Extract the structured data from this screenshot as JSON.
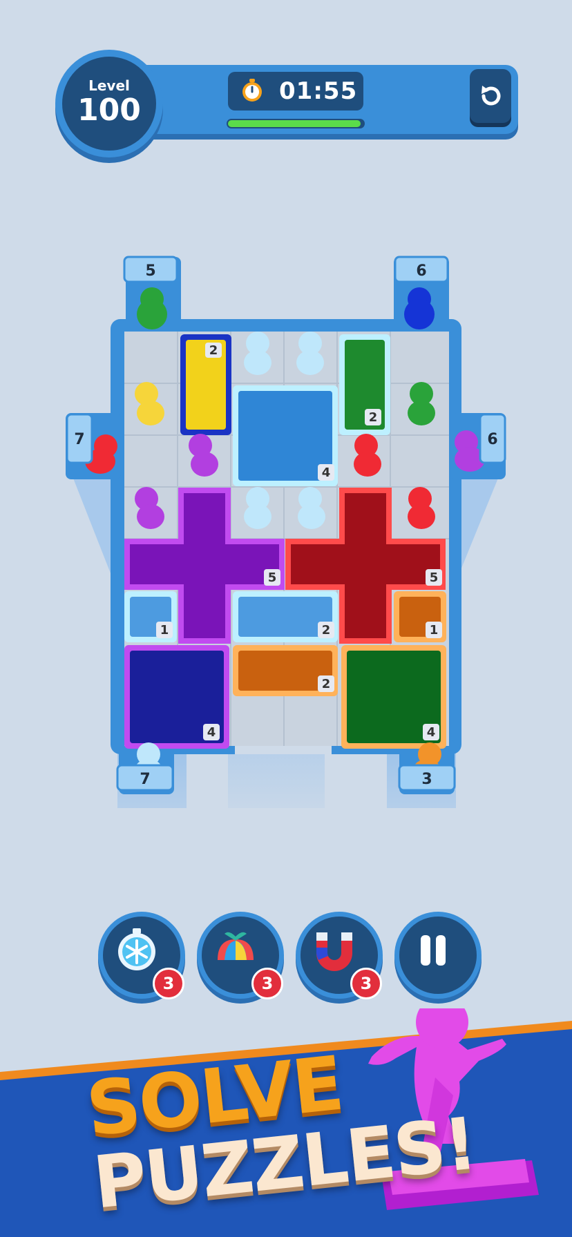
{
  "header": {
    "level_label": "Level",
    "level_number": "100",
    "timer": "01:55",
    "timer_progress": 0.98,
    "restart_icon": "restart-icon",
    "timer_icon": "stopwatch-icon"
  },
  "board": {
    "doors": {
      "top_left": "5",
      "top_right": "6",
      "left": "7",
      "right": "6",
      "bottom_left": "7",
      "bottom_right": "3"
    },
    "pieces": [
      {
        "name": "yellow-bar",
        "color": "#f2d21b",
        "count": "2"
      },
      {
        "name": "green-bar-top",
        "color": "#1e8a2e",
        "count": "2"
      },
      {
        "name": "blue-square",
        "color": "#2f86d6",
        "count": "4"
      },
      {
        "name": "purple-cross",
        "color": "#8a1fc2",
        "count": "5"
      },
      {
        "name": "red-cross",
        "color": "#c21a22",
        "count": "5"
      },
      {
        "name": "lightblue-small-left",
        "color": "#4d9be0",
        "count": "1"
      },
      {
        "name": "lightblue-bar-mid",
        "color": "#4d9be0",
        "count": "2"
      },
      {
        "name": "orange-small",
        "color": "#e07a19",
        "count": "1"
      },
      {
        "name": "navy-square",
        "color": "#1a1f9a",
        "count": "4"
      },
      {
        "name": "orange-bar",
        "color": "#e07a19",
        "count": "2"
      },
      {
        "name": "green-square",
        "color": "#1e8a2e",
        "count": "4"
      }
    ]
  },
  "powerups": [
    {
      "name": "freeze-time",
      "icon": "snowflake-stopwatch-icon",
      "count": "3"
    },
    {
      "name": "rotate",
      "icon": "propeller-cap-icon",
      "count": "3"
    },
    {
      "name": "magnet",
      "icon": "magnet-icon",
      "count": "3"
    },
    {
      "name": "pause",
      "icon": "pause-icon",
      "count": ""
    }
  ],
  "banner": {
    "line1": "SOLVE",
    "line2": "PUZZLES!"
  },
  "colors": {
    "background": "#cfdbe9",
    "ui_blue": "#3a8fd9",
    "ui_dark": "#1f4e7d",
    "banner_blue": "#1f56b8",
    "banner_stripe": "#f08a1e",
    "mascot": "#e24be8"
  }
}
